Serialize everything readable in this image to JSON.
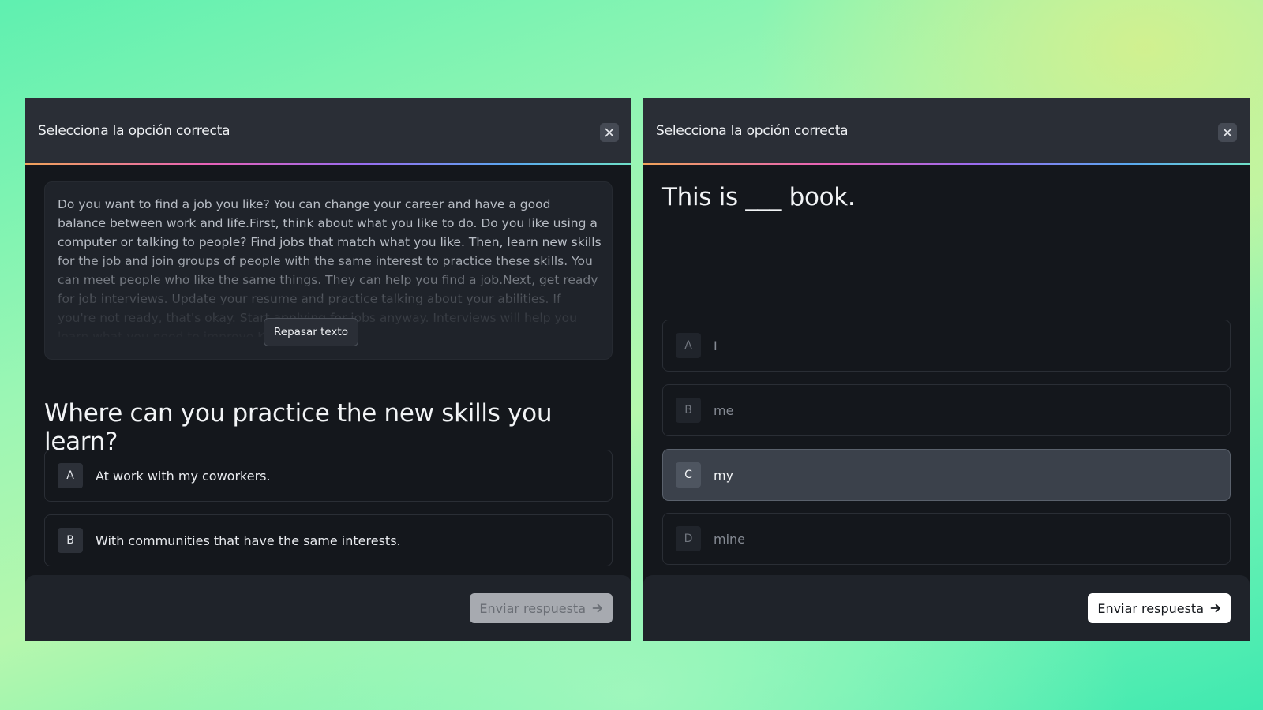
{
  "left_modal": {
    "title": "Selecciona la opción correcta",
    "passage": "Do you want to find a job you like? You can change your career and have a good balance between work and life.First, think about what you like to do. Do you like using a computer or talking to people? Find jobs that match what you like. Then, learn new skills for the job and join groups of people with the same interest to practice these skills. You can meet people who like the same things. They can help you find a job.Next, get ready for job interviews. Update your resume and practice talking about your abilities. If you're not ready, that's okay. Start applying for jobs anyway. Interviews will help you learn what you need to improve.Keep",
    "review_button": "Repasar texto",
    "question": "Where can you practice the new skills you learn?",
    "options": [
      {
        "letter": "A",
        "text": "At work with my coworkers."
      },
      {
        "letter": "B",
        "text": "With communities that have the same interests."
      }
    ],
    "submit": "Enviar respuesta",
    "submit_state": "disabled"
  },
  "right_modal": {
    "title": "Selecciona la opción correcta",
    "question": "This is ___ book.",
    "options": [
      {
        "letter": "A",
        "text": "I",
        "state": "dim"
      },
      {
        "letter": "B",
        "text": "me",
        "state": "dim"
      },
      {
        "letter": "C",
        "text": "my",
        "state": "selected"
      },
      {
        "letter": "D",
        "text": "mine",
        "state": "dim"
      }
    ],
    "submit": "Enviar respuesta",
    "submit_state": "enabled"
  },
  "colors": {
    "modal_bg": "#14171c",
    "header_bg": "#2a2e36",
    "selected_option_bg": "#3b414b",
    "accent_gradient": [
      "#f0a35a",
      "#e862b8",
      "#9a6cf0",
      "#5aa8f0",
      "#6fe0c8"
    ]
  },
  "icons": {
    "close": "close-icon",
    "submit_arrow": "arrow-right-icon"
  }
}
